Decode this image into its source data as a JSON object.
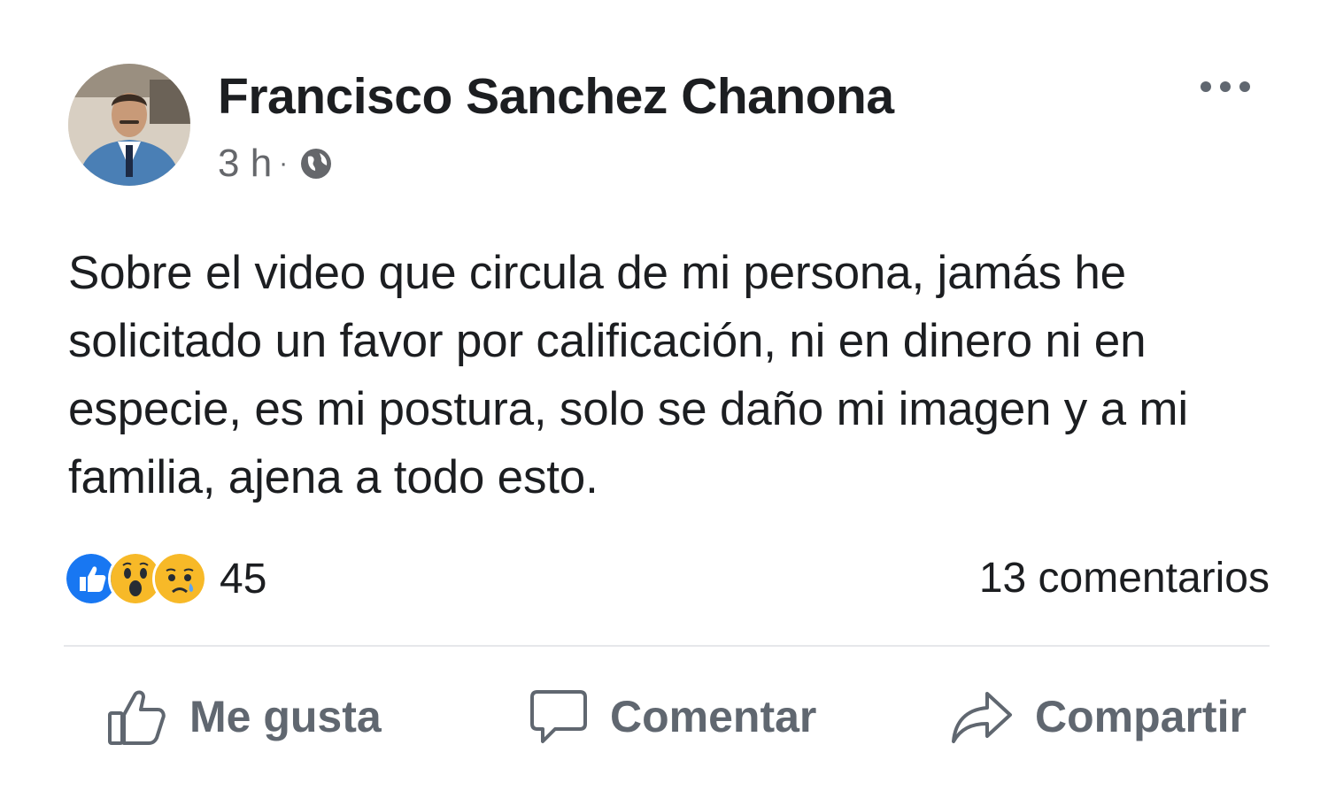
{
  "post": {
    "author_name": "Francisco Sanchez Chanona",
    "timestamp": "3 h",
    "separator": "·",
    "privacy_icon": "globe-icon",
    "text": "Sobre el video que circula de mi persona, jamás he solicitado un favor por calificación, ni en dinero ni en especie, es mi postura, solo se daño mi imagen y a mi familia, ajena a todo esto."
  },
  "stats": {
    "reactions": [
      "like",
      "wow",
      "sad"
    ],
    "reaction_count": "45",
    "comments": "13 comentarios"
  },
  "actions": {
    "like_label": "Me gusta",
    "comment_label": "Comentar",
    "share_label": "Compartir"
  },
  "colors": {
    "like_blue": "#1877f2",
    "reaction_yellow": "#f7b928",
    "secondary_text": "#65676b",
    "action_text": "#606770"
  }
}
